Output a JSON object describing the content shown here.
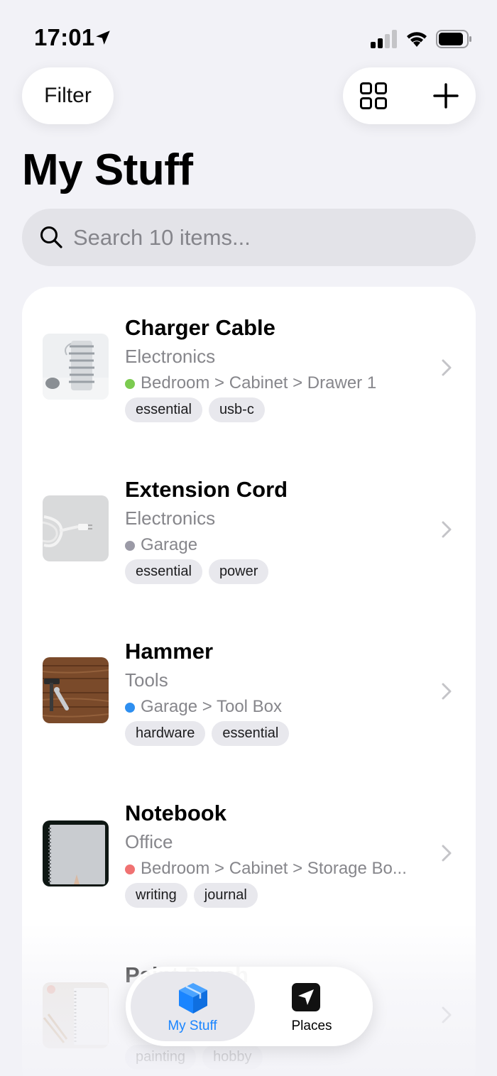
{
  "status_bar": {
    "time": "17:01"
  },
  "header": {
    "filter_label": "Filter",
    "title": "My Stuff"
  },
  "search": {
    "placeholder": "Search 10 items..."
  },
  "items": [
    {
      "title": "Charger Cable",
      "category": "Electronics",
      "location": "Bedroom > Cabinet > Drawer 1",
      "dot_color": "#7ccb50",
      "tags": [
        "essential",
        "usb-c"
      ]
    },
    {
      "title": "Extension Cord",
      "category": "Electronics",
      "location": "Garage",
      "dot_color": "#9b9aa6",
      "tags": [
        "essential",
        "power"
      ]
    },
    {
      "title": "Hammer",
      "category": "Tools",
      "location": "Garage > Tool Box",
      "dot_color": "#2e8ff0",
      "tags": [
        "hardware",
        "essential"
      ]
    },
    {
      "title": "Notebook",
      "category": "Office",
      "location": "Bedroom > Cabinet > Storage Bo...",
      "dot_color": "#f07272",
      "tags": [
        "writing",
        "journal"
      ]
    },
    {
      "title": "Paint Brush",
      "category": "",
      "location": "",
      "dot_color": "#c8c8cc",
      "tags": [
        "painting",
        "hobby"
      ]
    }
  ],
  "tabbar": {
    "tabs": [
      {
        "label": "My Stuff",
        "icon": "cube-icon",
        "active": true
      },
      {
        "label": "Places",
        "icon": "location-arrow-icon",
        "active": false
      }
    ]
  },
  "colors": {
    "accent": "#1a85ff",
    "background": "#f2f2f7"
  }
}
